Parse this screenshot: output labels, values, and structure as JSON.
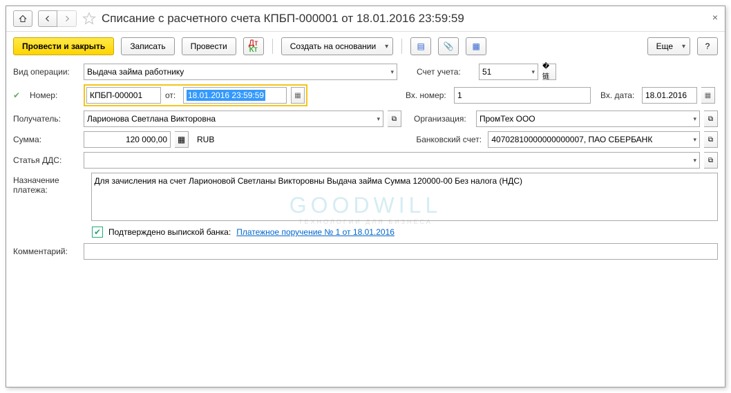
{
  "title": "Списание с расчетного счета КПБП-000001 от 18.01.2016 23:59:59",
  "toolbar": {
    "post_close": "Провести и закрыть",
    "save": "Записать",
    "post": "Провести",
    "create_based": "Создать на основании",
    "more": "Еще"
  },
  "labels": {
    "op_type": "Вид операции:",
    "number": "Номер:",
    "from": "от:",
    "account": "Счет учета:",
    "incoming_no": "Вх. номер:",
    "incoming_date": "Вх. дата:",
    "recipient": "Получатель:",
    "organization": "Организация:",
    "amount": "Сумма:",
    "bank_account": "Банковский счет:",
    "dds": "Статья ДДС:",
    "purpose": "Назначение платежа:",
    "confirmed": "Подтверждено выпиской банка:",
    "comment": "Комментарий:"
  },
  "fields": {
    "op_type": "Выдача займа работнику",
    "number": "КПБП-000001",
    "date": "18.01.2016 23:59:59",
    "account": "51",
    "incoming_no": "1",
    "incoming_date": "18.01.2016",
    "recipient": "Ларионова Светлана Викторовна",
    "organization": "ПромТех ООО",
    "amount": "120 000,00",
    "currency": "RUB",
    "bank_account": "40702810000000000007, ПАО СБЕРБАНК",
    "dds": "",
    "purpose": "Для зачисления на счет Ларионовой Светланы Викторовны Выдача займа Сумма 120000-00 Без налога (НДС)",
    "comment": ""
  },
  "link": "Платежное поручение № 1 от 18.01.2016",
  "watermark": {
    "big": "GOODWILL",
    "small": "ТЕХНОЛОГИИ ДЛЯ БИЗНЕСА"
  }
}
